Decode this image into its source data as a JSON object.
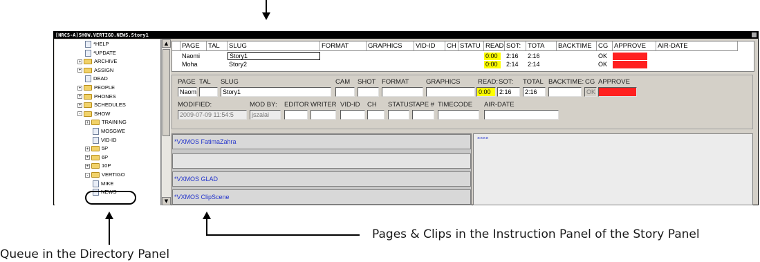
{
  "window": {
    "title": "[NRCS-A]SHOW.VERTIGO.NEWS.Story1"
  },
  "directory": {
    "items": [
      {
        "label": "*HELP",
        "icon": "document-icon",
        "expander": ""
      },
      {
        "label": "*UPDATE",
        "icon": "document-icon",
        "expander": ""
      },
      {
        "label": "ARCHIVE",
        "icon": "folder-icon",
        "expander": "+"
      },
      {
        "label": "ASSIGN",
        "icon": "folder-icon",
        "expander": "+"
      },
      {
        "label": "DEAD",
        "icon": "document-icon",
        "expander": ""
      },
      {
        "label": "PEOPLE",
        "icon": "folder-icon",
        "expander": "+"
      },
      {
        "label": "PHONES",
        "icon": "folder-icon",
        "expander": "+"
      },
      {
        "label": "SCHEDULES",
        "icon": "folder-icon",
        "expander": "+"
      },
      {
        "label": "SHOW",
        "icon": "folder-icon",
        "expander": "-"
      },
      {
        "label": "TRAINING",
        "icon": "folder-icon",
        "expander": "+"
      },
      {
        "label": "MOSGWE",
        "icon": "document-icon",
        "expander": ""
      },
      {
        "label": "VID-ID",
        "icon": "document-icon",
        "expander": ""
      },
      {
        "label": "5P",
        "icon": "folder-icon",
        "expander": "+"
      },
      {
        "label": "6P",
        "icon": "folder-icon",
        "expander": "+"
      },
      {
        "label": "10P",
        "icon": "folder-icon",
        "expander": "+"
      },
      {
        "label": "VERTIGO",
        "icon": "folder-icon",
        "expander": "-"
      },
      {
        "label": "MIKE",
        "icon": "document-icon",
        "expander": ""
      },
      {
        "label": "NEWS",
        "icon": "document-icon",
        "expander": ""
      }
    ]
  },
  "queue": {
    "columns": [
      "PAGE",
      "TAL",
      "SLUG",
      "FORMAT",
      "GRAPHICS",
      "VID-ID",
      "CH",
      "STATU",
      "READ",
      "SOT:",
      "TOTA",
      "BACKTIME",
      "CG",
      "APPROVE",
      "AIR-DATE"
    ],
    "rows": [
      {
        "page": "Naomi",
        "slug": "Story1",
        "read": "0:00",
        "sot": "2:16",
        "total": "2:16",
        "cg": "OK"
      },
      {
        "page": "Moha",
        "slug": "Story2",
        "read": "0:00",
        "sot": "2:14",
        "total": "2:14",
        "cg": "OK"
      }
    ]
  },
  "form": {
    "labels": {
      "page": "PAGE",
      "tal": "TAL",
      "slug": "SLUG",
      "cam": "CAM",
      "shot": "SHOT",
      "format": "FORMAT",
      "graphics": "GRAPHICS",
      "read": "READ:",
      "sot": "SOT:",
      "total": "TOTAL",
      "backtime": "BACKTIME:",
      "cg": "CG",
      "approve": "APPROVE",
      "modified": "MODIFIED:",
      "modby": "MOD BY:",
      "editor": "EDITOR",
      "writer": "WRITER",
      "vidid": "VID-ID",
      "ch": "CH",
      "status": "STATUS",
      "tape": "TAPE #",
      "timecode": "TIMECODE",
      "airdate": "AIR-DATE"
    },
    "values": {
      "page": "Naom",
      "slug": "Story1",
      "read": "0:00",
      "sot": "2:16",
      "total": "2:16",
      "cg": "OK",
      "modified": "2009-07-09 11:54:5",
      "modby": "jszalai"
    }
  },
  "instruction": {
    "bands": [
      "*VXMOS FatimaZahra",
      "",
      "*VXMOS GLAD",
      "*VXMOS ClipScene"
    ],
    "right_text": "××××"
  },
  "callouts": {
    "bottom_left": "Queue in the Directory Panel",
    "bottom_right": "Pages & Clips in the Instruction Panel of the Story Panel"
  },
  "colors": {
    "read_highlight": "#ffff00",
    "approve_highlight": "#ff2020",
    "instruction_text": "#2233cc"
  }
}
